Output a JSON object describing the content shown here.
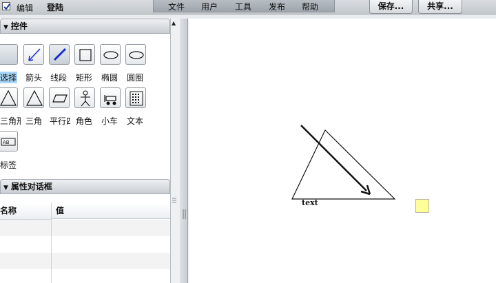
{
  "topbar": {
    "edit_label": "编辑",
    "login_label": "登陆",
    "menu": [
      "文件",
      "用户",
      "工具",
      "发布",
      "帮助"
    ],
    "save_label": "保存...",
    "share_label": "共享..."
  },
  "controls_panel": {
    "title": "控件",
    "tools": [
      {
        "label": "选择",
        "icon": "select-icon"
      },
      {
        "label": "箭头",
        "icon": "arrow-icon"
      },
      {
        "label": "线段",
        "icon": "line-icon"
      },
      {
        "label": "矩形",
        "icon": "rectangle-icon"
      },
      {
        "label": "椭圆",
        "icon": "ellipse-icon"
      },
      {
        "label": "圆圈",
        "icon": "circle-icon"
      },
      {
        "label": "三角形",
        "icon": "right-triangle-icon"
      },
      {
        "label": "三角",
        "icon": "triangle-icon"
      },
      {
        "label": "平行四",
        "icon": "parallelogram-icon"
      },
      {
        "label": "角色",
        "icon": "actor-icon"
      },
      {
        "label": "小车",
        "icon": "cart-icon"
      },
      {
        "label": "文本",
        "icon": "text-icon"
      },
      {
        "label": "标签",
        "icon": "tag-icon"
      }
    ]
  },
  "properties_panel": {
    "title": "属性对话框",
    "col_name": "名称",
    "col_value": "值"
  },
  "canvas": {
    "text_label": "text",
    "note_color": "#ffff99"
  },
  "colors": {
    "selected_tool_label": "#a9d6f7",
    "line_tool_stroke": "#1a2bd6"
  }
}
